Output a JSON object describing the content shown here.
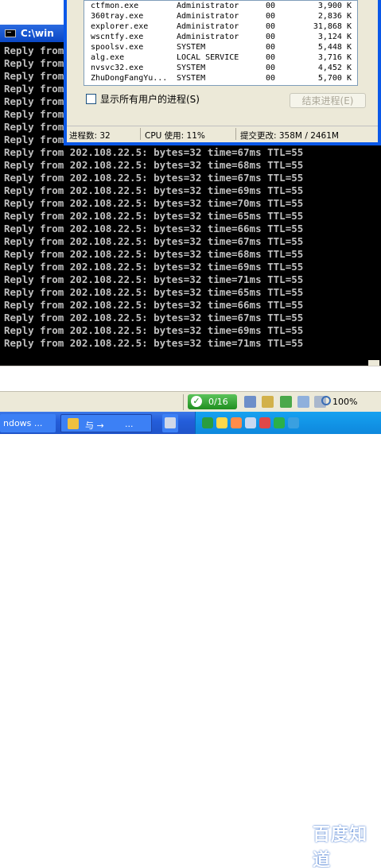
{
  "cmd": {
    "title": "C:\\win",
    "hidden_lines": [
      "Reply from",
      "Reply from",
      "Reply from",
      "Reply from",
      "Reply from",
      "Reply from",
      "Reply from",
      "Reply from"
    ],
    "lines": [
      "Reply from 202.108.22.5: bytes=32 time=67ms TTL=55",
      "Reply from 202.108.22.5: bytes=32 time=68ms TTL=55",
      "Reply from 202.108.22.5: bytes=32 time=67ms TTL=55",
      "Reply from 202.108.22.5: bytes=32 time=69ms TTL=55",
      "Reply from 202.108.22.5: bytes=32 time=70ms TTL=55",
      "Reply from 202.108.22.5: bytes=32 time=65ms TTL=55",
      "Reply from 202.108.22.5: bytes=32 time=66ms TTL=55",
      "Reply from 202.108.22.5: bytes=32 time=67ms TTL=55",
      "Reply from 202.108.22.5: bytes=32 time=68ms TTL=55",
      "Reply from 202.108.22.5: bytes=32 time=69ms TTL=55",
      "Reply from 202.108.22.5: bytes=32 time=71ms TTL=55",
      "Reply from 202.108.22.5: bytes=32 time=65ms TTL=55",
      "Reply from 202.108.22.5: bytes=32 time=66ms TTL=55",
      "Reply from 202.108.22.5: bytes=32 time=67ms TTL=55",
      "Reply from 202.108.22.5: bytes=32 time=69ms TTL=55",
      "Reply from 202.108.22.5: bytes=32 time=71ms TTL=55"
    ]
  },
  "task_manager": {
    "processes": [
      {
        "name": "ctfmon.exe",
        "user": "Administrator",
        "cpu": "00",
        "mem": "3,900 K"
      },
      {
        "name": "360tray.exe",
        "user": "Administrator",
        "cpu": "00",
        "mem": "2,836 K"
      },
      {
        "name": "explorer.exe",
        "user": "Administrator",
        "cpu": "00",
        "mem": "31,868 K"
      },
      {
        "name": "wscntfy.exe",
        "user": "Administrator",
        "cpu": "00",
        "mem": "3,124 K"
      },
      {
        "name": "spoolsv.exe",
        "user": "SYSTEM",
        "cpu": "00",
        "mem": "5,448 K"
      },
      {
        "name": "alg.exe",
        "user": "LOCAL SERVICE",
        "cpu": "00",
        "mem": "3,716 K"
      },
      {
        "name": "nvsvc32.exe",
        "user": "SYSTEM",
        "cpu": "00",
        "mem": "4,452 K"
      },
      {
        "name": "ZhuDongFangYu...",
        "user": "SYSTEM",
        "cpu": "00",
        "mem": "5,700 K"
      }
    ],
    "show_all_users_label": "显示所有用户的进程(S)",
    "show_all_users_checked": false,
    "end_process_label": "结束进程(E)",
    "status": {
      "processes": "进程数: 32",
      "cpu": "CPU 使用: 11%",
      "commit": "提交更改: 358M / 2461M"
    }
  },
  "browser_status": {
    "zone_label": "0/16",
    "zoom": "100%"
  },
  "taskbar": {
    "btn_a": "ndows ...",
    "btn_b": "与 →",
    "btn_b_dots": "...",
    "watermark": "百度知道"
  },
  "colors": {
    "console_bg": "#000000",
    "console_text": "#c0c0c0",
    "xp_blue": "#0a58e8",
    "dialog_bg": "#ece9d8"
  }
}
